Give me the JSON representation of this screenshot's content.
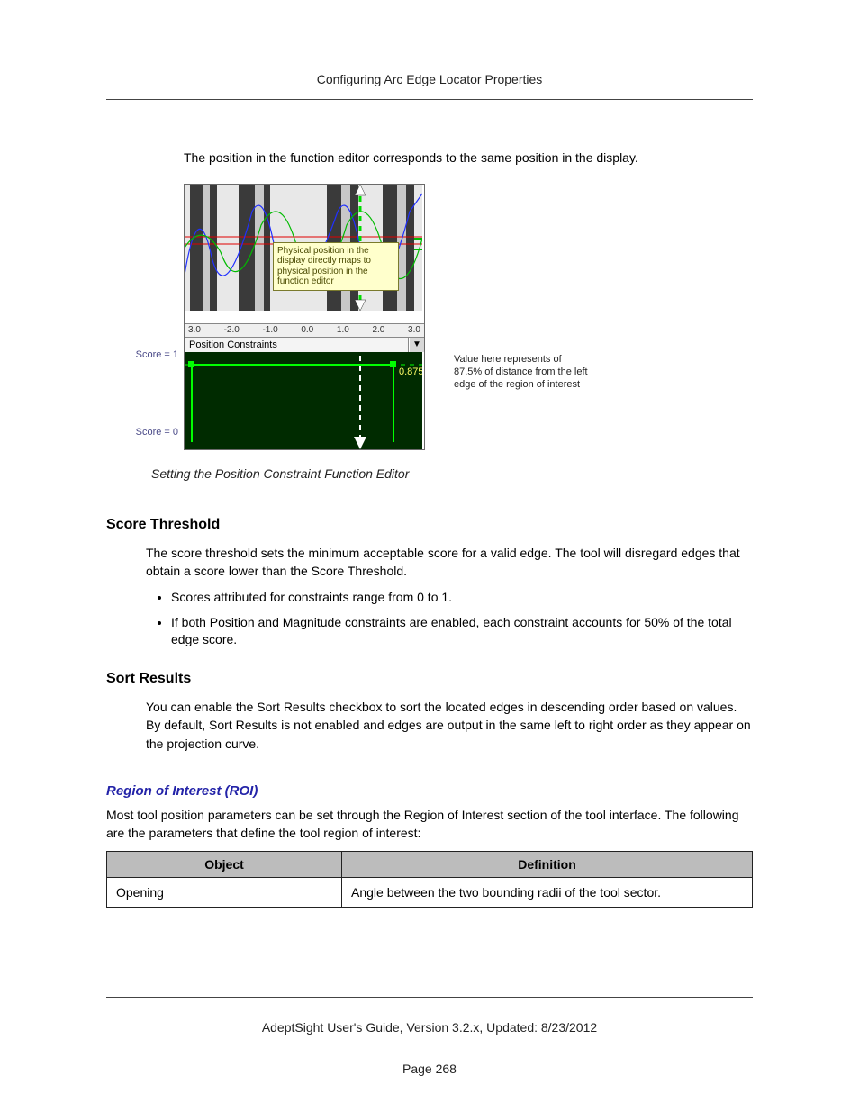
{
  "header": "Configuring Arc Edge Locator Properties",
  "intro": "The position in the function editor corresponds to the same position in the display.",
  "figure": {
    "overlay_note": "Physical position in the display directly maps to physical position in the function editor",
    "axis": [
      "3.0",
      "-2.0",
      "-1.0",
      "0.0",
      "1.0",
      "2.0",
      "3.0"
    ],
    "dropdown": "Position Constraints",
    "score_value": "0.875",
    "score1": "Score = 1",
    "score0": "Score = 0",
    "right_note": "Value here represents of 87.5% of distance from the left edge of the region of interest",
    "caption": "Setting the Position Constraint Function Editor"
  },
  "sections": {
    "score_title": "Score Threshold",
    "score_text": "The score threshold sets the minimum acceptable score for a valid edge. The tool will disregard edges that obtain a score lower than the Score Threshold.",
    "bullets": [
      "Scores attributed for constraints range from 0 to 1.",
      "If both Position and Magnitude constraints are enabled, each constraint accounts for 50% of the total edge score."
    ],
    "sort_title": "Sort Results",
    "sort_text": "You can enable the Sort Results checkbox to sort the located edges in descending order based on values. By default, Sort Results is not enabled and edges are output in the same left to right order as they appear on the projection curve."
  },
  "roi": {
    "title": "Region of Interest (ROI)",
    "text": "Most tool position parameters can be set through the Region of Interest section of the tool interface. The following are the parameters that define the tool region of interest:",
    "table": {
      "h1": "Object",
      "h2": "Definition",
      "r1c1": "Opening",
      "r1c2": "Angle between the two bounding radii of the tool sector."
    }
  },
  "footer": {
    "line1": "AdeptSight User's Guide,  Version 3.2.x, Updated: 8/23/2012",
    "page": "Page 268"
  }
}
